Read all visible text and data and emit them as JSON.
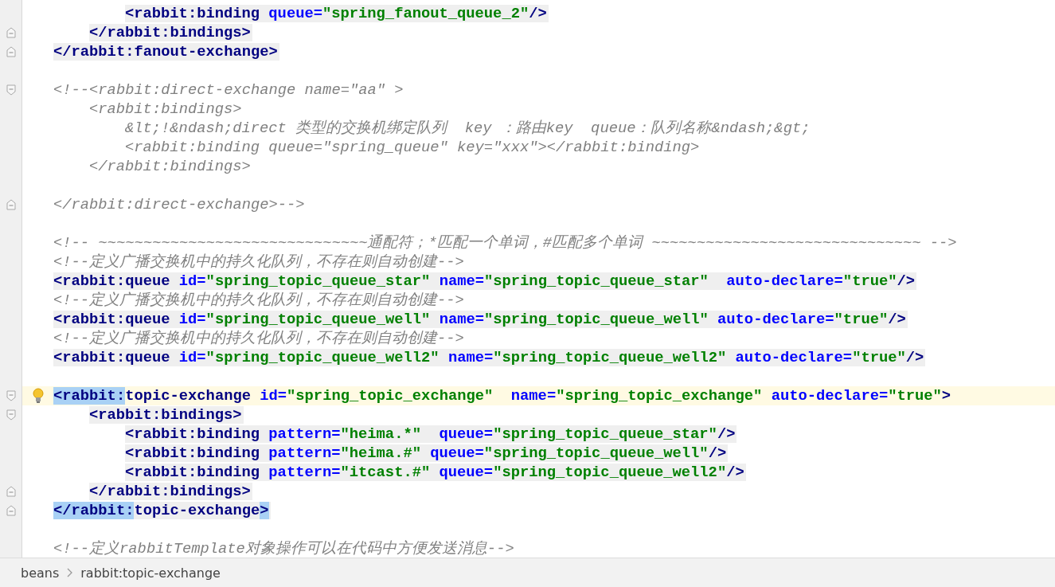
{
  "editor": {
    "lines": [
      {
        "kind": "group",
        "children": [
          {
            "kind": "group",
            "children": [
              {
                "kind": "code",
                "shaded": true,
                "current": false,
                "segments": [
                  {
                    "kind": "tag",
                    "text": "<rabbit:binding "
                  },
                  {
                    "kind": "attr",
                    "text": "queue="
                  },
                  {
                    "kind": "value",
                    "text": "\"spring_fanout_queue_2\""
                  },
                  {
                    "kind": "tag",
                    "text": "/>"
                  }
                ]
              }
            ]
          },
          {
            "kind": "code",
            "shaded": true,
            "current": false,
            "fold_end": true,
            "segments": [
              {
                "kind": "tag",
                "text": "</rabbit:bindings>"
              }
            ]
          }
        ]
      },
      {
        "kind": "code",
        "shaded": true,
        "current": false,
        "fold_end": true,
        "segments": [
          {
            "kind": "tag",
            "text": "</rabbit:fanout-exchange>"
          }
        ]
      },
      {
        "kind": "blank"
      },
      {
        "kind": "code",
        "shaded": false,
        "current": false,
        "fold_start": true,
        "segments": [
          {
            "kind": "comment",
            "text": "<!--<rabbit:direct-exchange name=\"aa\" >"
          }
        ],
        "children": [
          {
            "kind": "code",
            "shaded": false,
            "current": false,
            "segments": [
              {
                "kind": "comment",
                "text": "<rabbit:bindings>"
              }
            ],
            "children": [
              {
                "kind": "code",
                "shaded": false,
                "current": false,
                "segments": [
                  {
                    "kind": "comment",
                    "text": "&lt;!&ndash;direct 类型的交换机绑定队列  key ：路由key  queue：队列名称&ndash;&gt;"
                  }
                ]
              },
              {
                "kind": "code",
                "shaded": false,
                "current": false,
                "segments": [
                  {
                    "kind": "comment",
                    "text": "<rabbit:binding queue=\"spring_queue\" key=\"xxx\"></rabbit:binding>"
                  }
                ]
              }
            ]
          },
          {
            "kind": "code",
            "shaded": false,
            "current": false,
            "segments": [
              {
                "kind": "comment",
                "text": "</rabbit:bindings>"
              }
            ]
          },
          {
            "kind": "blank"
          }
        ]
      },
      {
        "kind": "code",
        "shaded": false,
        "current": false,
        "fold_end": true,
        "segments": [
          {
            "kind": "comment",
            "text": "</rabbit:direct-exchange>-->"
          }
        ]
      },
      {
        "kind": "blank"
      },
      {
        "kind": "code",
        "shaded": false,
        "current": false,
        "segments": [
          {
            "kind": "comment",
            "text": "<!-- ~~~~~~~~~~~~~~~~~~~~~~~~~~~~~~通配符；*匹配一个单词，#匹配多个单词 ~~~~~~~~~~~~~~~~~~~~~~~~~~~~~~ -->"
          }
        ]
      },
      {
        "kind": "code",
        "shaded": false,
        "current": false,
        "segments": [
          {
            "kind": "comment",
            "text": "<!--定义广播交换机中的持久化队列，不存在则自动创建-->"
          }
        ]
      },
      {
        "kind": "code",
        "shaded": true,
        "current": false,
        "segments": [
          {
            "kind": "tag",
            "text": "<rabbit:queue "
          },
          {
            "kind": "attr",
            "text": "id="
          },
          {
            "kind": "value",
            "text": "\"spring_topic_queue_star\" "
          },
          {
            "kind": "attr",
            "text": "name="
          },
          {
            "kind": "value",
            "text": "\"spring_topic_queue_star\"  "
          },
          {
            "kind": "attr",
            "text": "auto-declare="
          },
          {
            "kind": "value",
            "text": "\"true\""
          },
          {
            "kind": "tag",
            "text": "/>"
          }
        ]
      },
      {
        "kind": "code",
        "shaded": false,
        "current": false,
        "segments": [
          {
            "kind": "comment",
            "text": "<!--定义广播交换机中的持久化队列，不存在则自动创建-->"
          }
        ]
      },
      {
        "kind": "code",
        "shaded": true,
        "current": false,
        "segments": [
          {
            "kind": "tag",
            "text": "<rabbit:queue "
          },
          {
            "kind": "attr",
            "text": "id="
          },
          {
            "kind": "value",
            "text": "\"spring_topic_queue_well\" "
          },
          {
            "kind": "attr",
            "text": "name="
          },
          {
            "kind": "value",
            "text": "\"spring_topic_queue_well\" "
          },
          {
            "kind": "attr",
            "text": "auto-declare="
          },
          {
            "kind": "value",
            "text": "\"true\""
          },
          {
            "kind": "tag",
            "text": "/>"
          }
        ]
      },
      {
        "kind": "code",
        "shaded": false,
        "current": false,
        "segments": [
          {
            "kind": "comment",
            "text": "<!--定义广播交换机中的持久化队列，不存在则自动创建-->"
          }
        ]
      },
      {
        "kind": "code",
        "shaded": true,
        "current": false,
        "segments": [
          {
            "kind": "tag",
            "text": "<rabbit:queue "
          },
          {
            "kind": "attr",
            "text": "id="
          },
          {
            "kind": "value",
            "text": "\"spring_topic_queue_well2\" "
          },
          {
            "kind": "attr",
            "text": "name="
          },
          {
            "kind": "value",
            "text": "\"spring_topic_queue_well2\" "
          },
          {
            "kind": "attr",
            "text": "auto-declare="
          },
          {
            "kind": "value",
            "text": "\"true\""
          },
          {
            "kind": "tag",
            "text": "/>"
          }
        ]
      },
      {
        "kind": "blank"
      },
      {
        "kind": "code",
        "shaded": false,
        "current": true,
        "fold_start": true,
        "bulb": true,
        "segments": [
          {
            "kind": "tag_match",
            "text": "<rabbit:"
          },
          {
            "kind": "tag",
            "text": "topic-exchange "
          },
          {
            "kind": "attr",
            "text": "id="
          },
          {
            "kind": "value",
            "text": "\"spring_topic_exchange\"  "
          },
          {
            "kind": "attr",
            "text": "name="
          },
          {
            "kind": "value",
            "text": "\"spring_topic_exchange\" "
          },
          {
            "kind": "attr",
            "text": "auto-declare="
          },
          {
            "kind": "value",
            "text": "\"true\""
          },
          {
            "kind": "tag",
            "text": ">"
          }
        ],
        "children": [
          {
            "kind": "code",
            "shaded": true,
            "current": false,
            "fold_start": true,
            "segments": [
              {
                "kind": "tag",
                "text": "<rabbit:bindings>"
              }
            ],
            "children": [
              {
                "kind": "code",
                "shaded": true,
                "current": false,
                "segments": [
                  {
                    "kind": "tag",
                    "text": "<rabbit:binding "
                  },
                  {
                    "kind": "attr",
                    "text": "pattern="
                  },
                  {
                    "kind": "value",
                    "text": "\"heima.*\"  "
                  },
                  {
                    "kind": "attr",
                    "text": "queue="
                  },
                  {
                    "kind": "value",
                    "text": "\"spring_topic_queue_star\""
                  },
                  {
                    "kind": "tag",
                    "text": "/>"
                  }
                ]
              },
              {
                "kind": "code",
                "shaded": true,
                "current": false,
                "segments": [
                  {
                    "kind": "tag",
                    "text": "<rabbit:binding "
                  },
                  {
                    "kind": "attr",
                    "text": "pattern="
                  },
                  {
                    "kind": "value",
                    "text": "\"heima.#\" "
                  },
                  {
                    "kind": "attr",
                    "text": "queue="
                  },
                  {
                    "kind": "value",
                    "text": "\"spring_topic_queue_well\""
                  },
                  {
                    "kind": "tag",
                    "text": "/>"
                  }
                ]
              },
              {
                "kind": "code",
                "shaded": true,
                "current": false,
                "segments": [
                  {
                    "kind": "tag",
                    "text": "<rabbit:binding "
                  },
                  {
                    "kind": "attr",
                    "text": "pattern="
                  },
                  {
                    "kind": "value",
                    "text": "\"itcast.#\" "
                  },
                  {
                    "kind": "attr",
                    "text": "queue="
                  },
                  {
                    "kind": "value",
                    "text": "\"spring_topic_queue_well2\""
                  },
                  {
                    "kind": "tag",
                    "text": "/>"
                  }
                ]
              }
            ]
          },
          {
            "kind": "code",
            "shaded": true,
            "current": false,
            "fold_end": true,
            "segments": [
              {
                "kind": "tag",
                "text": "</rabbit:bindings>"
              }
            ]
          }
        ]
      },
      {
        "kind": "code",
        "shaded": true,
        "current": false,
        "fold_end": true,
        "segments": [
          {
            "kind": "tag_match",
            "text": "</rabbit:"
          },
          {
            "kind": "tag",
            "text": "topic-exchange"
          },
          {
            "kind": "tag_match",
            "text": ">"
          }
        ]
      },
      {
        "kind": "blank"
      },
      {
        "kind": "code",
        "shaded": false,
        "current": false,
        "segments": [
          {
            "kind": "comment",
            "text": "<!--定义rabbitTemplate对象操作可以在代码中方便发送消息-->"
          }
        ]
      }
    ]
  },
  "breadcrumbs": [
    "beans",
    "rabbit:topic-exchange"
  ]
}
